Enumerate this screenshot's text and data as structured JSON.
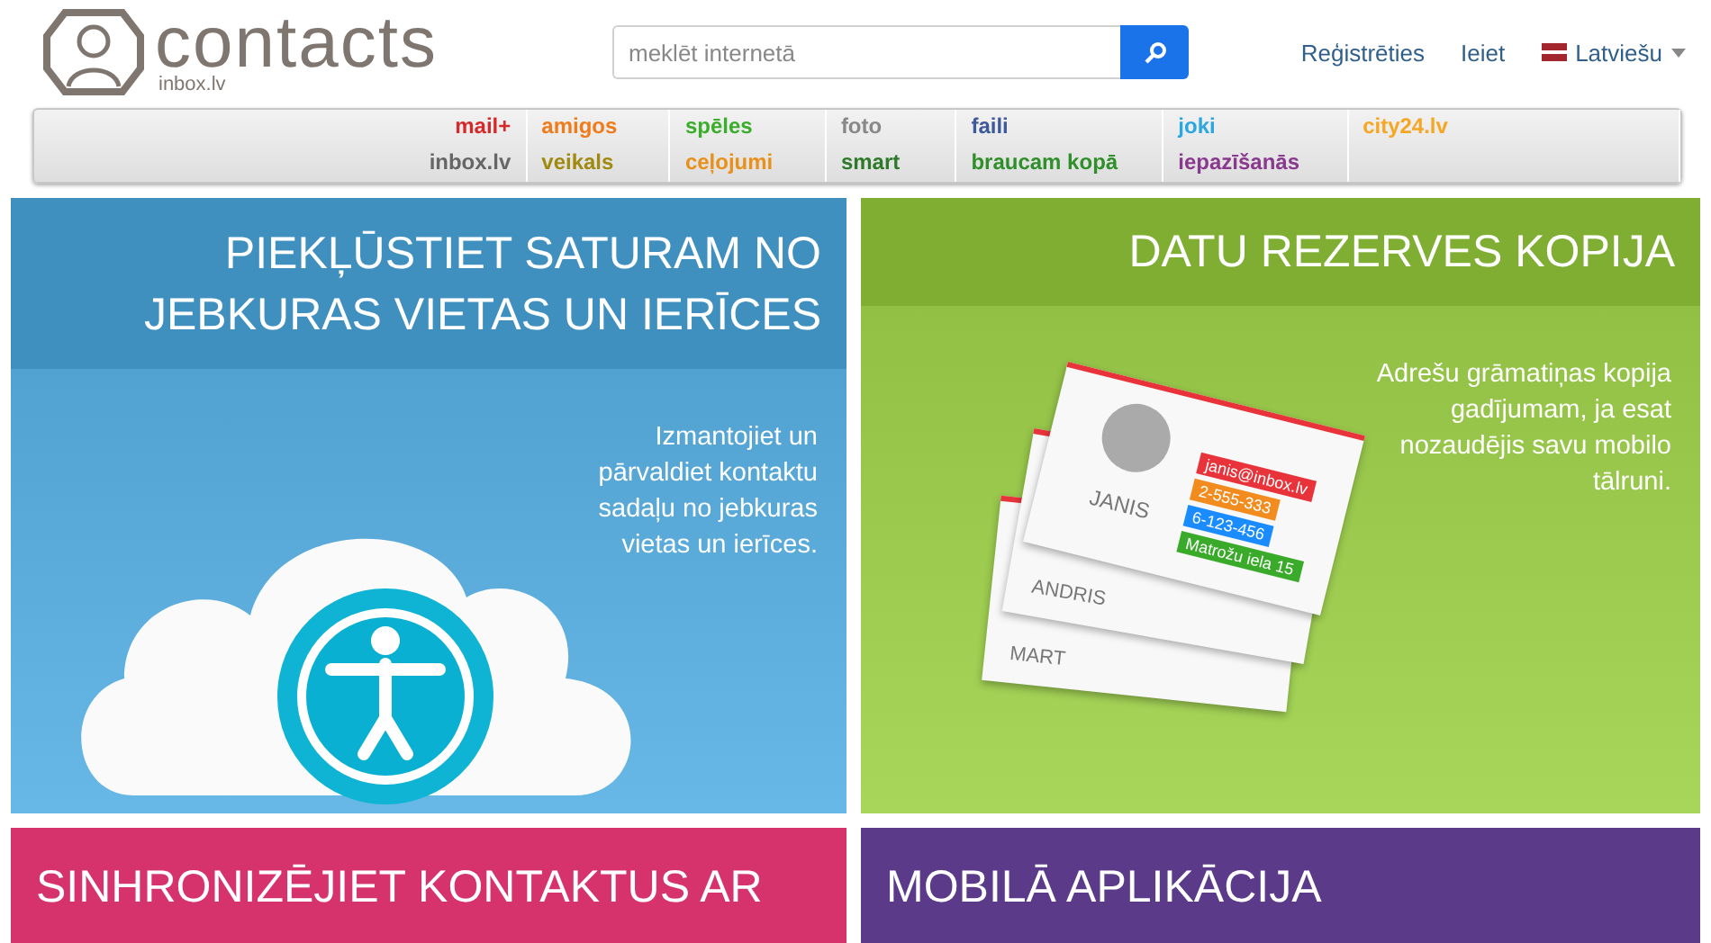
{
  "logo": {
    "word": "contacts",
    "sub": "inbox.lv"
  },
  "search": {
    "placeholder": "meklēt internetā"
  },
  "header_links": [
    {
      "label": "Reģistrēties"
    },
    {
      "label": "Ieiet"
    }
  ],
  "language": {
    "label": "Latviešu"
  },
  "nav_columns": [
    [
      {
        "label": "mail+",
        "color": "#d42a2a"
      },
      {
        "label": "inbox.lv",
        "color": "#666666"
      }
    ],
    [
      {
        "label": "amigos",
        "color": "#f07b1a"
      },
      {
        "label": "veikals",
        "color": "#a08a10"
      }
    ],
    [
      {
        "label": "spēles",
        "color": "#3aae2a"
      },
      {
        "label": "ceļojumi",
        "color": "#e8901a"
      }
    ],
    [
      {
        "label": "foto",
        "color": "#888888"
      },
      {
        "label": "smart",
        "color": "#2f7a2a"
      }
    ],
    [
      {
        "label": "faili",
        "color": "#3f5a9a"
      },
      {
        "label": "braucam kopā",
        "color": "#2f8f2a"
      }
    ],
    [
      {
        "label": "joki",
        "color": "#2aa7e0"
      },
      {
        "label": "iepazīšanās",
        "color": "#8a3a8e"
      }
    ],
    [
      {
        "label": "city24.lv",
        "color": "#f5a623"
      }
    ]
  ],
  "panels": [
    {
      "kind": "cloud",
      "title": "PIEKĻŪSTIET SATURAM NO JEBKURAS VIETAS UN IERĪCES",
      "text": "Izmantojiet un pārvaldiet kontaktu sadaļu no jebkuras vietas un ierīces.",
      "color": "#3f8fbf"
    },
    {
      "kind": "cards",
      "title": "DATU REZERVES KOPIJA",
      "text": "Adrešu grāmatiņas kopija gadījumam, ja esat nozaudējis savu mobilo tālruni.",
      "color": "#7fae32",
      "cards": {
        "names": [
          "JANIS",
          "ANDRIS",
          "MART"
        ],
        "lines": [
          "janis@inbox.lv",
          "2-555-333",
          "6-123-456",
          "Matrožu iela 15"
        ]
      }
    },
    {
      "kind": "plain",
      "title": "SINHRONIZĒJIET KONTAKTUS AR",
      "color": "#d6336c"
    },
    {
      "kind": "plain",
      "title": "MOBILĀ APLIKĀCIJA",
      "color": "#5b3a8a"
    }
  ]
}
